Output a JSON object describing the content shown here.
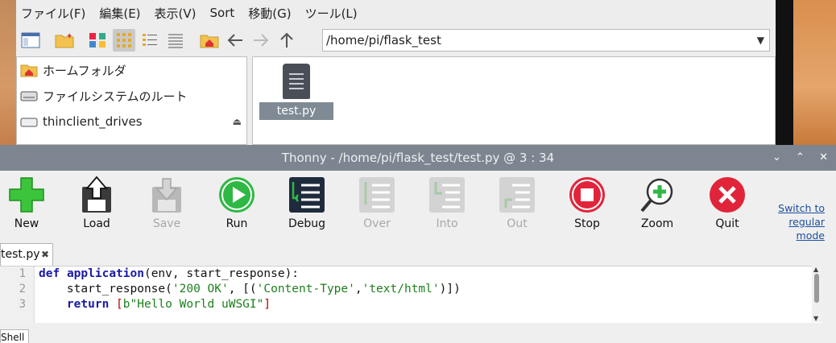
{
  "file_manager": {
    "menu": [
      "ファイル(F)",
      "編集(E)",
      "表示(V)",
      "Sort",
      "移動(G)",
      "ツール(L)"
    ],
    "path": "/home/pi/flask_test",
    "sidebar": [
      {
        "label": "ホームフォルダ"
      },
      {
        "label": "ファイルシステムのルート"
      },
      {
        "label": "thinclient_drives"
      }
    ],
    "file": {
      "name": "test.py"
    }
  },
  "thonny": {
    "title": "Thonny  -  /home/pi/flask_test/test.py  @  3 : 34",
    "toolbar": {
      "new": "New",
      "load": "Load",
      "save": "Save",
      "run": "Run",
      "debug": "Debug",
      "over": "Over",
      "into": "Into",
      "out": "Out",
      "stop": "Stop",
      "zoom": "Zoom",
      "quit": "Quit"
    },
    "switch_mode": [
      "Switch to",
      "regular",
      "mode"
    ],
    "tab": "test.py",
    "line_numbers": [
      "1",
      "2",
      "3"
    ],
    "code": {
      "l1_kw": "def",
      "l1_name": "application",
      "l1_rest": "(env, start_response):",
      "l2_a": "    start_response(",
      "l2_s1": "'200 OK'",
      "l2_b": ", [(",
      "l2_s2": "'Content-Type'",
      "l2_c": ",",
      "l2_s3": "'text/html'",
      "l2_d": ")])",
      "l3_kw": "    return",
      "l3_b1": " [",
      "l3_s": "b\"Hello World uWSGI\"",
      "l3_b2": "]"
    },
    "shell_tab": "Shell"
  },
  "colors": {
    "titlebar": "#7d8690",
    "run_green": "#2fb844",
    "stop_red": "#e0253a",
    "keyword_blue": "#1a1aa6",
    "string_green": "#1d7f1d"
  }
}
